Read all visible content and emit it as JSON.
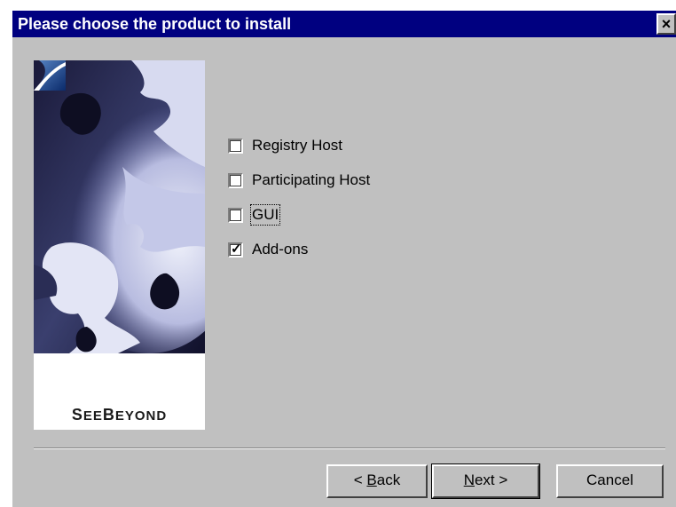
{
  "window": {
    "title": "Please choose the product to install",
    "close_label": "×",
    "titlebar_color": "#000080",
    "face_color": "#c0c0c0"
  },
  "banner": {
    "brand_first": "S",
    "brand_rest1": "EE",
    "brand_b": "B",
    "brand_rest2": "EYOND",
    "logo": "seebeyond-logo",
    "image": "gears-image"
  },
  "options": [
    {
      "label": "Registry Host",
      "checked": false,
      "focused": false
    },
    {
      "label": "Participating Host",
      "checked": false,
      "focused": false
    },
    {
      "label": "GUI",
      "checked": false,
      "focused": true
    },
    {
      "label": "Add-ons",
      "checked": true,
      "focused": false
    }
  ],
  "buttons": {
    "back_prefix": "< ",
    "back_mnemonic": "B",
    "back_rest": "ack",
    "next_mnemonic": "N",
    "next_rest": "ext >",
    "cancel": "Cancel"
  }
}
